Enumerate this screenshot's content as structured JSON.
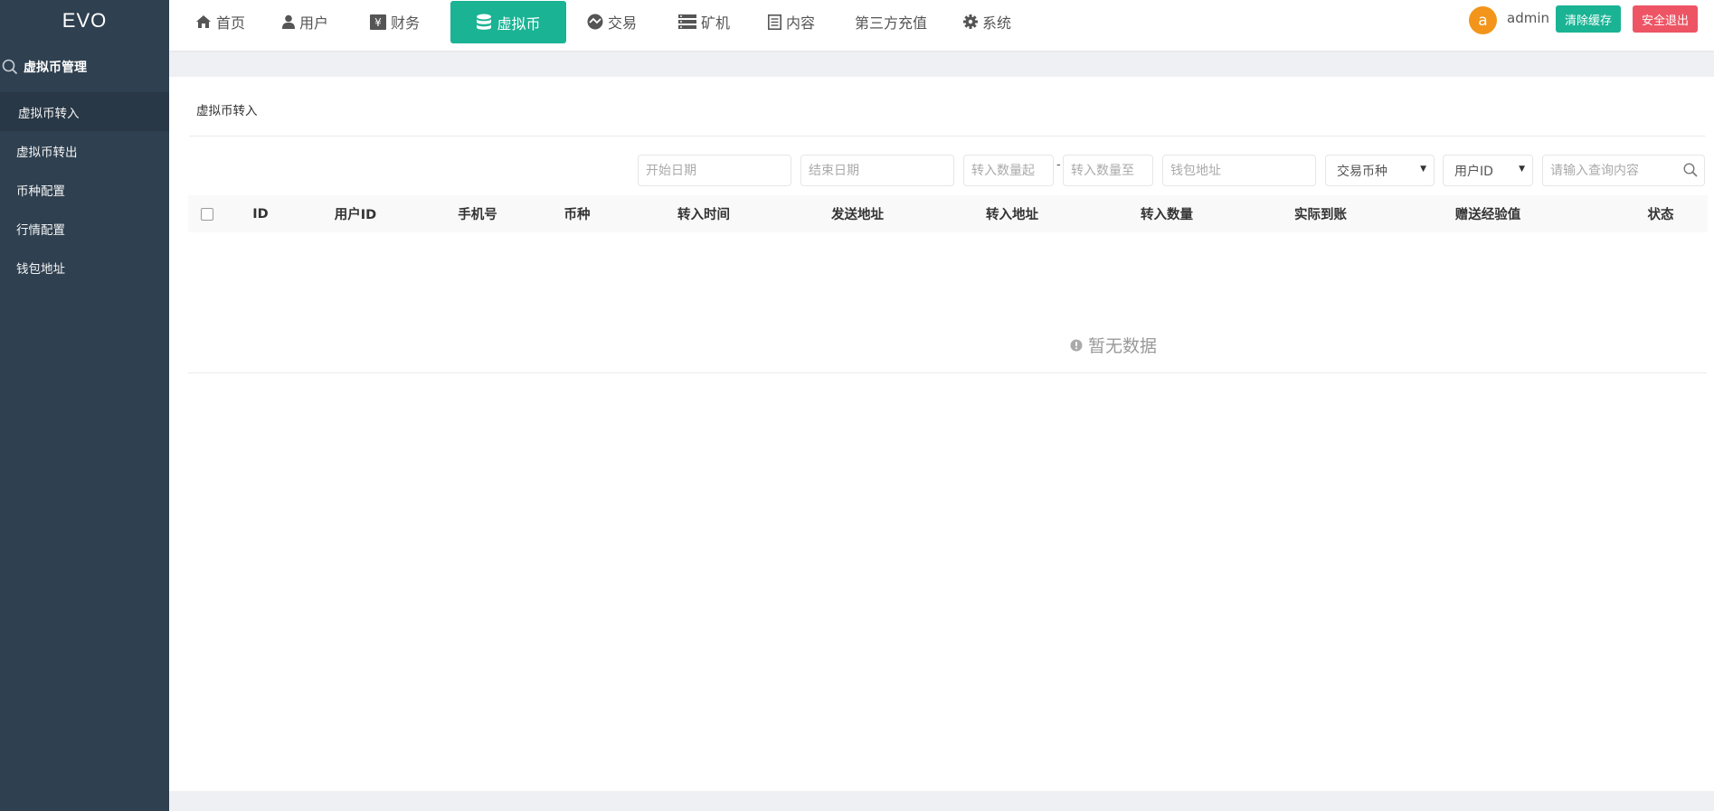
{
  "app": {
    "logo": "EVO"
  },
  "sidebar": {
    "section_title": "虚拟币管理",
    "section_icon": "search-icon",
    "items": [
      {
        "label": "虚拟币转入",
        "active": true
      },
      {
        "label": "虚拟币转出",
        "active": false
      },
      {
        "label": "币种配置",
        "active": false
      },
      {
        "label": "行情配置",
        "active": false
      },
      {
        "label": "钱包地址",
        "active": false
      }
    ]
  },
  "topnav": {
    "items": [
      {
        "label": "首页",
        "icon": "home-icon",
        "active": false
      },
      {
        "label": "用户",
        "icon": "user-icon",
        "active": false
      },
      {
        "label": "财务",
        "icon": "yen-icon",
        "active": false
      },
      {
        "label": "虚拟币",
        "icon": "database-icon",
        "active": true
      },
      {
        "label": "交易",
        "icon": "exchange-icon",
        "active": false
      },
      {
        "label": "矿机",
        "icon": "server-icon",
        "active": false
      },
      {
        "label": "内容",
        "icon": "document-icon",
        "active": false
      },
      {
        "label": "第三方充值",
        "icon": "",
        "active": false
      },
      {
        "label": "系统",
        "icon": "gear-icon",
        "active": false
      }
    ],
    "user": {
      "avatar_letter": "a",
      "name": "admin"
    },
    "clear_cache_label": "清除缓存",
    "logout_label": "安全退出"
  },
  "page": {
    "title": "虚拟币转入",
    "filters": {
      "start_date_placeholder": "开始日期",
      "end_date_placeholder": "结束日期",
      "amount_from_placeholder": "转入数量起",
      "range_separator": "-",
      "amount_to_placeholder": "转入数量至",
      "wallet_placeholder": "钱包地址",
      "coin_select": "交易币种",
      "field_select": "用户ID",
      "search_placeholder": "请输入查询内容"
    },
    "table": {
      "columns": [
        "ID",
        "用户ID",
        "手机号",
        "币种",
        "转入时间",
        "发送地址",
        "转入地址",
        "转入数量",
        "实际到账",
        "赠送经验值",
        "状态"
      ],
      "rows": [],
      "empty_text": "暂无数据"
    }
  },
  "colors": {
    "sidebar_bg": "#2f4050",
    "sidebar_active": "#293846",
    "primary": "#1ab394",
    "danger": "#ed5565",
    "avatar": "#f3951b",
    "page_bg": "#eff0f4"
  }
}
